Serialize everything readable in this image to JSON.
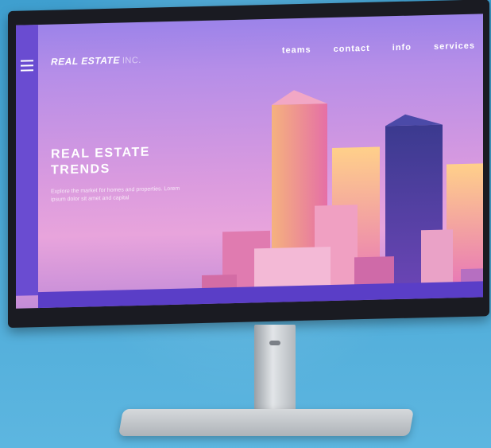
{
  "header": {
    "brand": "REAL ESTATE",
    "brand_suffix": "INC.",
    "menu_icon": "hamburger-menu-icon",
    "nav": [
      "teams",
      "contact",
      "info",
      "services"
    ]
  },
  "hero": {
    "title": "REAL ESTATE TRENDS",
    "subtitle": "Explore the market for homes and properties. Lorem ipsum dolor sit amet and capital"
  },
  "colors": {
    "sky_top": "#9c83e9",
    "sky_bottom": "#e8a4dc",
    "sidebar": "#6a4cd1",
    "ground": "#5a3ec7",
    "backdrop": "#4aa8d6"
  }
}
